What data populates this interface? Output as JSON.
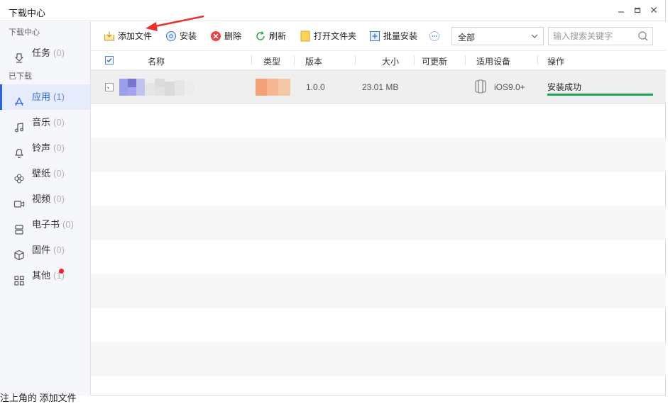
{
  "window": {
    "title": "下载中心",
    "minimize_icon": "minimize-icon",
    "maximize_icon": "maximize-icon",
    "close_icon": "close-icon"
  },
  "sidebar": {
    "groups": [
      {
        "label": "下载中心"
      },
      {
        "label": "已下载"
      }
    ],
    "items": [
      {
        "label": "任务",
        "count": "(0)",
        "icon": "download-icon"
      },
      {
        "label": "应用",
        "count": "(1)",
        "icon": "app-store-icon",
        "active": true
      },
      {
        "label": "音乐",
        "count": "(0)",
        "icon": "music-icon"
      },
      {
        "label": "铃声",
        "count": "(0)",
        "icon": "bell-icon"
      },
      {
        "label": "壁纸",
        "count": "(0)",
        "icon": "wallpaper-icon"
      },
      {
        "label": "视频",
        "count": "(0)",
        "icon": "video-icon"
      },
      {
        "label": "电子书",
        "count": "(0)",
        "icon": "ebook-icon"
      },
      {
        "label": "固件",
        "count": "(0)",
        "icon": "firmware-icon"
      },
      {
        "label": "其他",
        "count": "(1)",
        "icon": "grid-icon",
        "badge": true
      }
    ]
  },
  "toolbar": {
    "add_file": "添加文件",
    "install": "安装",
    "delete": "删除",
    "refresh": "刷新",
    "open_folder": "打开文件夹",
    "batch_install": "批量安装",
    "filter_value": "全部",
    "search_placeholder": "输入搜索关键字"
  },
  "table": {
    "columns": [
      "名称",
      "类型",
      "版本",
      "大小",
      "可更新",
      "适用设备",
      "操作"
    ],
    "rows": [
      {
        "name": "",
        "type": "",
        "version": "1.0.0",
        "size": "23.01 MB",
        "updatable": "",
        "device": "iOS9.0+",
        "action": "安装成功",
        "progress": 1.0
      }
    ]
  },
  "caption": "注上角的 添加文件",
  "colors": {
    "accent": "#2f63e6",
    "success": "#1aa35b",
    "annotation_arrow": "#e8302f"
  }
}
